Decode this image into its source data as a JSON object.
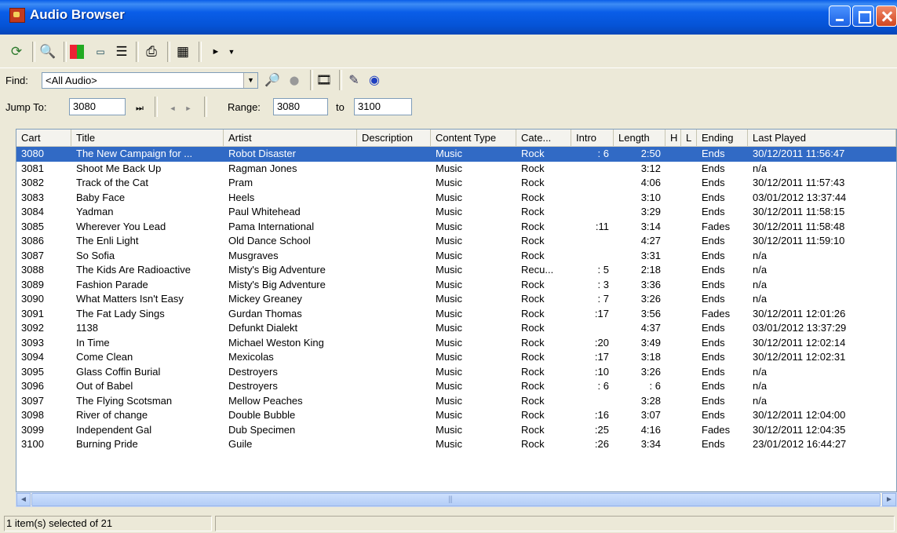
{
  "window": {
    "title": "Audio Browser"
  },
  "toolbar": {
    "icons": [
      "refresh-icon",
      "search-icon",
      "color-grid-icon",
      "tape-icon",
      "list-icon",
      "print-icon",
      "calculator-icon",
      "play-icon",
      "dropdown-arrow-icon"
    ]
  },
  "find": {
    "label": "Find:",
    "value": "<All Audio>",
    "icons": [
      "search-folder-icon",
      "stop-icon",
      "film-icon",
      "edit-wand-icon",
      "target-icon"
    ]
  },
  "jump": {
    "label": "Jump To:",
    "value": "3080",
    "range_label": "Range:",
    "range_from": "3080",
    "to_label": "to",
    "range_to": "3100"
  },
  "columns": [
    "Cart",
    "Title",
    "Artist",
    "Description",
    "Content Type",
    "Cate...",
    "Intro",
    "Length",
    "H",
    "L",
    "Ending",
    "Last Played"
  ],
  "rows": [
    {
      "cart": "3080",
      "title": "The New Campaign for ...",
      "artist": "Robot Disaster",
      "description": "",
      "type": "Music",
      "category": "Rock",
      "intro": ": 6",
      "length": "2:50",
      "h": "",
      "l": "",
      "ending": "Ends",
      "last": "30/12/2011 11:56:47",
      "selected": true
    },
    {
      "cart": "3081",
      "title": "Shoot Me Back Up",
      "artist": "Ragman Jones",
      "description": "",
      "type": "Music",
      "category": "Rock",
      "intro": "",
      "length": "3:12",
      "h": "",
      "l": "",
      "ending": "Ends",
      "last": "n/a"
    },
    {
      "cart": "3082",
      "title": "Track of the Cat",
      "artist": "Pram",
      "description": "",
      "type": "Music",
      "category": "Rock",
      "intro": "",
      "length": "4:06",
      "h": "",
      "l": "",
      "ending": "Ends",
      "last": "30/12/2011 11:57:43"
    },
    {
      "cart": "3083",
      "title": "Baby Face",
      "artist": "Heels",
      "description": "",
      "type": "Music",
      "category": "Rock",
      "intro": "",
      "length": "3:10",
      "h": "",
      "l": "",
      "ending": "Ends",
      "last": "03/01/2012 13:37:44"
    },
    {
      "cart": "3084",
      "title": "Yadman",
      "artist": "Paul Whitehead",
      "description": "",
      "type": "Music",
      "category": "Rock",
      "intro": "",
      "length": "3:29",
      "h": "",
      "l": "",
      "ending": "Ends",
      "last": "30/12/2011 11:58:15"
    },
    {
      "cart": "3085",
      "title": "Wherever You Lead",
      "artist": "Pama International",
      "description": "",
      "type": "Music",
      "category": "Rock",
      "intro": ":11",
      "length": "3:14",
      "h": "",
      "l": "",
      "ending": "Fades",
      "last": "30/12/2011 11:58:48"
    },
    {
      "cart": "3086",
      "title": "The Enli Light",
      "artist": "Old Dance School",
      "description": "",
      "type": "Music",
      "category": "Rock",
      "intro": "",
      "length": "4:27",
      "h": "",
      "l": "",
      "ending": "Ends",
      "last": "30/12/2011 11:59:10"
    },
    {
      "cart": "3087",
      "title": "So Sofia",
      "artist": "Musgraves",
      "description": "",
      "type": "Music",
      "category": "Rock",
      "intro": "",
      "length": "3:31",
      "h": "",
      "l": "",
      "ending": "Ends",
      "last": "n/a"
    },
    {
      "cart": "3088",
      "title": "The Kids Are Radioactive",
      "artist": "Misty's Big Adventure",
      "description": "",
      "type": "Music",
      "category": "Recu...",
      "intro": ": 5",
      "length": "2:18",
      "h": "",
      "l": "",
      "ending": "Ends",
      "last": "n/a"
    },
    {
      "cart": "3089",
      "title": "Fashion Parade",
      "artist": "Misty's Big Adventure",
      "description": "",
      "type": "Music",
      "category": "Rock",
      "intro": ": 3",
      "length": "3:36",
      "h": "",
      "l": "",
      "ending": "Ends",
      "last": "n/a"
    },
    {
      "cart": "3090",
      "title": "What Matters Isn't Easy",
      "artist": "Mickey Greaney",
      "description": "",
      "type": "Music",
      "category": "Rock",
      "intro": ": 7",
      "length": "3:26",
      "h": "",
      "l": "",
      "ending": "Ends",
      "last": "n/a"
    },
    {
      "cart": "3091",
      "title": "The Fat Lady Sings",
      "artist": "Gurdan Thomas",
      "description": "",
      "type": "Music",
      "category": "Rock",
      "intro": ":17",
      "length": "3:56",
      "h": "",
      "l": "",
      "ending": "Fades",
      "last": "30/12/2011 12:01:26"
    },
    {
      "cart": "3092",
      "title": "1138",
      "artist": "Defunkt Dialekt",
      "description": "",
      "type": "Music",
      "category": "Rock",
      "intro": "",
      "length": "4:37",
      "h": "",
      "l": "",
      "ending": "Ends",
      "last": "03/01/2012 13:37:29"
    },
    {
      "cart": "3093",
      "title": "In Time",
      "artist": "Michael Weston King",
      "description": "",
      "type": "Music",
      "category": "Rock",
      "intro": ":20",
      "length": "3:49",
      "h": "",
      "l": "",
      "ending": "Ends",
      "last": "30/12/2011 12:02:14"
    },
    {
      "cart": "3094",
      "title": "Come Clean",
      "artist": "Mexicolas",
      "description": "",
      "type": "Music",
      "category": "Rock",
      "intro": ":17",
      "length": "3:18",
      "h": "",
      "l": "",
      "ending": "Ends",
      "last": "30/12/2011 12:02:31"
    },
    {
      "cart": "3095",
      "title": "Glass Coffin Burial",
      "artist": "Destroyers",
      "description": "",
      "type": "Music",
      "category": "Rock",
      "intro": ":10",
      "length": "3:26",
      "h": "",
      "l": "",
      "ending": "Ends",
      "last": "n/a"
    },
    {
      "cart": "3096",
      "title": "Out of Babel",
      "artist": "Destroyers",
      "description": "",
      "type": "Music",
      "category": "Rock",
      "intro": ": 6",
      "length": ": 6",
      "h": "",
      "l": "",
      "ending": "Ends",
      "last": "n/a"
    },
    {
      "cart": "3097",
      "title": "The Flying Scotsman",
      "artist": "Mellow Peaches",
      "description": "",
      "type": "Music",
      "category": "Rock",
      "intro": "",
      "length": "3:28",
      "h": "",
      "l": "",
      "ending": "Ends",
      "last": "n/a"
    },
    {
      "cart": "3098",
      "title": "River of change",
      "artist": "Double Bubble",
      "description": "",
      "type": "Music",
      "category": "Rock",
      "intro": ":16",
      "length": "3:07",
      "h": "",
      "l": "",
      "ending": "Ends",
      "last": "30/12/2011 12:04:00"
    },
    {
      "cart": "3099",
      "title": "Independent Gal",
      "artist": "Dub Specimen",
      "description": "",
      "type": "Music",
      "category": "Rock",
      "intro": ":25",
      "length": "4:16",
      "h": "",
      "l": "",
      "ending": "Fades",
      "last": "30/12/2011 12:04:35"
    },
    {
      "cart": "3100",
      "title": "Burning Pride",
      "artist": "Guile",
      "description": "",
      "type": "Music",
      "category": "Rock",
      "intro": ":26",
      "length": "3:34",
      "h": "",
      "l": "",
      "ending": "Ends",
      "last": "23/01/2012 16:44:27"
    }
  ],
  "status": {
    "text": "1 item(s) selected of 21"
  },
  "colors": {
    "titlebar": "#0a5ee8",
    "selection": "#316ac5",
    "chrome": "#ece9d8"
  }
}
